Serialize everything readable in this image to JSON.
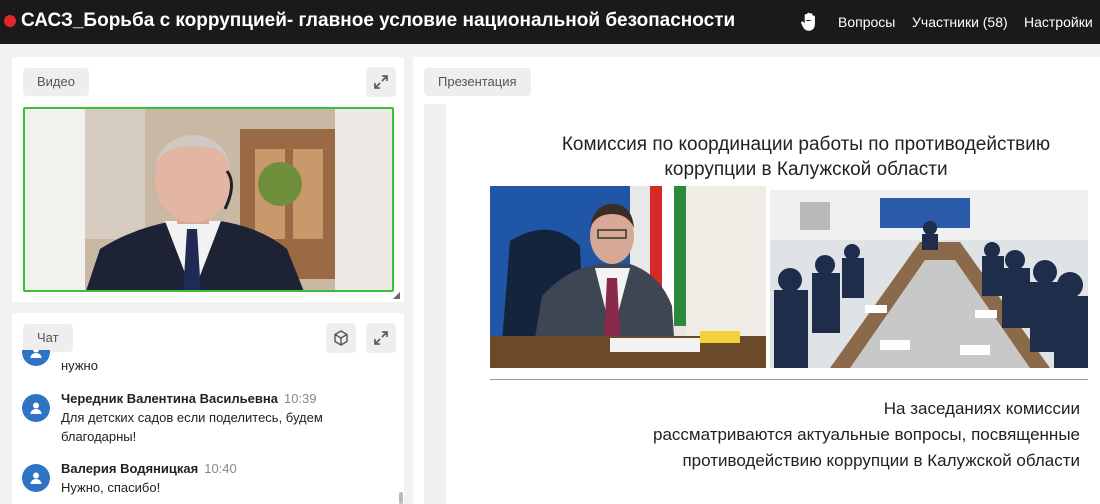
{
  "header": {
    "title": "САСЗ_Борьба с коррупцией- главное условие национальной безопасности",
    "nav": [
      "Вопросы",
      "Участники (58)",
      "Настройки"
    ]
  },
  "video": {
    "label": "Видео"
  },
  "presentation": {
    "label": "Презентация",
    "slide_title_lines": [
      "Комиссия по координации работы по противодействию",
      "коррупции в Калужской области"
    ],
    "slide_text_lines": [
      "На заседаниях комиссии",
      "рассматриваются актуальные вопросы, посвященные",
      "противодействию коррупции в Калужской области"
    ]
  },
  "chat": {
    "label": "Чат",
    "messages": [
      {
        "name": "",
        "time": "",
        "lines": [
          "нужно"
        ]
      },
      {
        "name": "Чередник Валентина Васильевна",
        "time": "10:39",
        "lines": [
          "Для детских садов если поделитесь, будем",
          "благодарны!"
        ]
      },
      {
        "name": "Валерия Водяницкая",
        "time": "10:40",
        "lines": [
          "Нужно, спасибо!"
        ]
      }
    ]
  },
  "colors": {
    "accent_green": "#3bbf3b",
    "avatar_blue": "#2f73c4",
    "record_red": "#e02828",
    "topbar": "#1a1a1a"
  }
}
